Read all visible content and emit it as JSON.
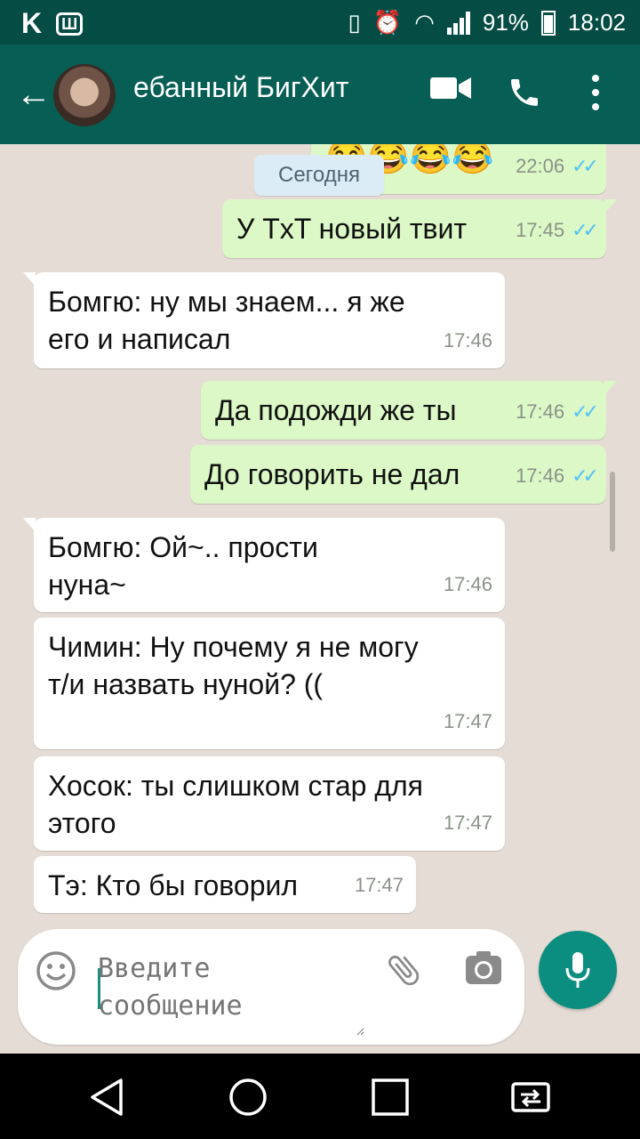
{
  "status_bar": {
    "left_icons": [
      "K",
      "Ш"
    ],
    "battery": "91%",
    "time": "18:02"
  },
  "header": {
    "title": "ебанный БигХит",
    "back_icon": "arrow-left-icon",
    "video_icon": "video-camera-icon",
    "call_icon": "phone-icon",
    "more_icon": "more-vert-icon"
  },
  "chat": {
    "date_chip": "Сегодня",
    "top_partial": {
      "emoji": "😂😂😂😂",
      "time": "22:06",
      "ticks": "✓✓"
    },
    "messages": [
      {
        "dir": "out",
        "text": "У TxT новый твит",
        "time": "17:45",
        "ticks": "✓✓"
      },
      {
        "dir": "in",
        "text": "Бомгю: ну мы знаем... я же его и написал",
        "time": "17:46"
      },
      {
        "dir": "out",
        "text": "Да подожди же ты",
        "time": "17:46",
        "ticks": "✓✓"
      },
      {
        "dir": "out",
        "text": "До говорить не дал",
        "time": "17:46",
        "ticks": "✓✓"
      },
      {
        "dir": "in",
        "text": "Бомгю: Ой~.. прости нуна~",
        "time": "17:46"
      },
      {
        "dir": "in",
        "text": "Чимин: Ну почему я не могу т/и назвать нуной? ((",
        "time": "17:47"
      },
      {
        "dir": "in",
        "text": "Хосок: ты слишком стар для этого",
        "time": "17:47"
      },
      {
        "dir": "in",
        "text": "Тэ: Кто бы говорил",
        "time": "17:47"
      }
    ]
  },
  "composer": {
    "placeholder": "Введите сообщение",
    "emoji_icon": "smiley-icon",
    "attach_icon": "paperclip-icon",
    "camera_icon": "camera-icon",
    "mic_icon": "microphone-icon"
  },
  "colors": {
    "appbar": "#075e54",
    "statusbar": "#054d44",
    "outgoing_bubble": "#dcf8c6",
    "incoming_bubble": "#ffffff",
    "read_ticks": "#4fc3f7",
    "mic_button": "#0b8e7f"
  }
}
